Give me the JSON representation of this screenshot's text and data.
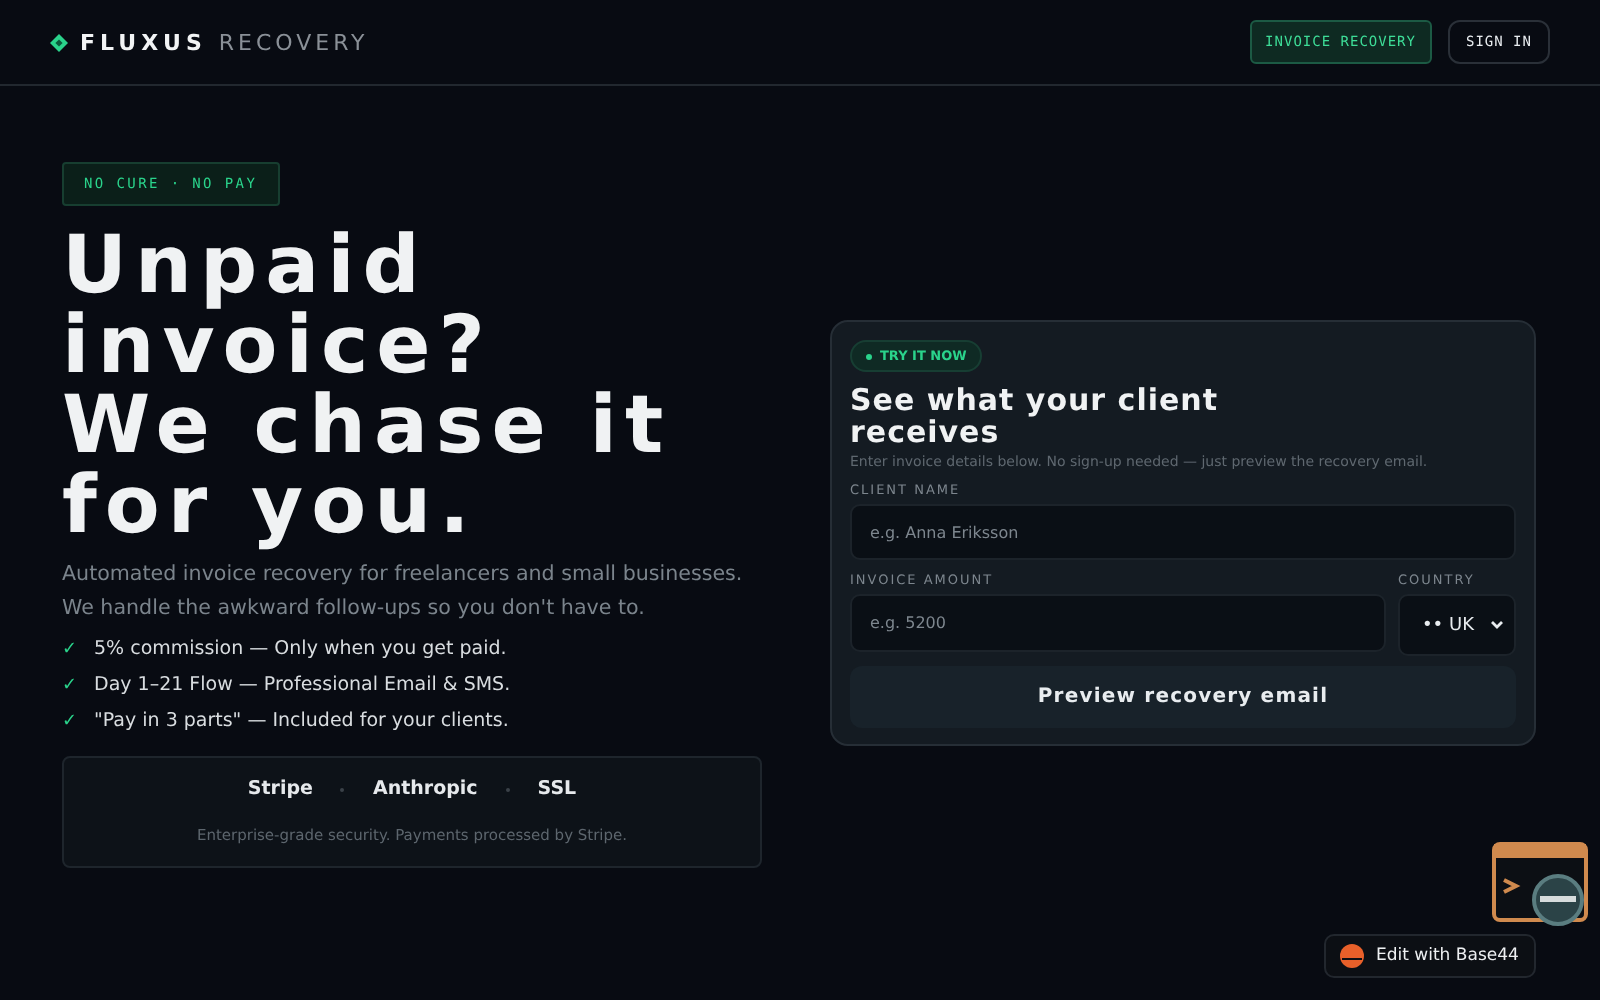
{
  "header": {
    "brand": "FLUXUS",
    "brand_suffix": "RECOVERY",
    "nav": [
      {
        "label": "INVOICE RECOVERY",
        "selected": true
      },
      {
        "label": "SIGN IN",
        "selected": false
      }
    ]
  },
  "hero": {
    "tag": "NO CURE · NO PAY",
    "headline": [
      "Unpaid",
      "invoice?",
      "We chase it",
      "for you."
    ],
    "intro": [
      "Automated invoice recovery for freelancers and small businesses.",
      "We handle the awkward follow-ups so you don't have to."
    ],
    "features": [
      {
        "check": "✓",
        "text": "5% commission — Only when you get paid."
      },
      {
        "check": "✓",
        "text": "Day 1–21 Flow — Professional Email & SMS."
      },
      {
        "check": "✓",
        "text": "\"Pay in 3 parts\" — Included for your clients."
      }
    ],
    "trust": {
      "partners": [
        "Stripe",
        "Anthropic",
        "SSL"
      ],
      "note": "Enterprise-grade security. Payments processed by Stripe."
    }
  },
  "demo": {
    "badge": "TRY IT NOW",
    "title": "See what your client receives",
    "subtitle": "Enter invoice details below. No sign-up needed — just preview the recovery email.",
    "client_label": "CLIENT NAME",
    "client_placeholder": "e.g. Anna Eriksson",
    "amount_label": "INVOICE AMOUNT",
    "amount_placeholder": "e.g. 5200",
    "country_label": "COUNTRY",
    "country_value": "•• UK",
    "button": "Preview recovery email"
  },
  "edit_badge": {
    "label": "Edit with Base44"
  }
}
